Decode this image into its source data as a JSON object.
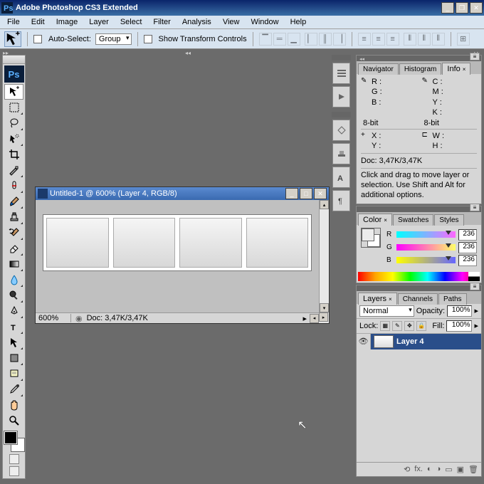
{
  "window": {
    "title": "Adobe Photoshop CS3 Extended"
  },
  "menu": [
    "File",
    "Edit",
    "Image",
    "Layer",
    "Select",
    "Filter",
    "Analysis",
    "View",
    "Window",
    "Help"
  ],
  "options": {
    "auto_select_label": "Auto-Select:",
    "auto_select_value": "Group",
    "show_transform_label": "Show Transform Controls"
  },
  "toolbox": {
    "logo": "Ps"
  },
  "document": {
    "title": "Untitled-1 @ 600% (Layer 4, RGB/8)",
    "zoom": "600%",
    "docsize": "Doc: 3,47K/3,47K"
  },
  "info_panel": {
    "tabs": [
      "Navigator",
      "Histogram",
      "Info"
    ],
    "rgb": {
      "R": "R :",
      "G": "G :",
      "B": "B :",
      "bits": "8-bit"
    },
    "cmyk": {
      "C": "C :",
      "M": "M :",
      "Y": "Y :",
      "K": "K :",
      "bits": "8-bit"
    },
    "xy": {
      "X": "X :",
      "Y": "Y :"
    },
    "wh": {
      "W": "W :",
      "H": "H :"
    },
    "docline": "Doc: 3,47K/3,47K",
    "hint": "Click and drag to move layer or selection.  Use Shift and Alt for additional options."
  },
  "color_panel": {
    "tabs": [
      "Color",
      "Swatches",
      "Styles"
    ],
    "R": "236",
    "G": "236",
    "B": "236"
  },
  "layers_panel": {
    "tabs": [
      "Layers",
      "Channels",
      "Paths"
    ],
    "blend": "Normal",
    "opacity_label": "Opacity:",
    "opacity": "100%",
    "lock_label": "Lock:",
    "fill_label": "Fill:",
    "fill": "100%",
    "layer_name": "Layer 4"
  }
}
